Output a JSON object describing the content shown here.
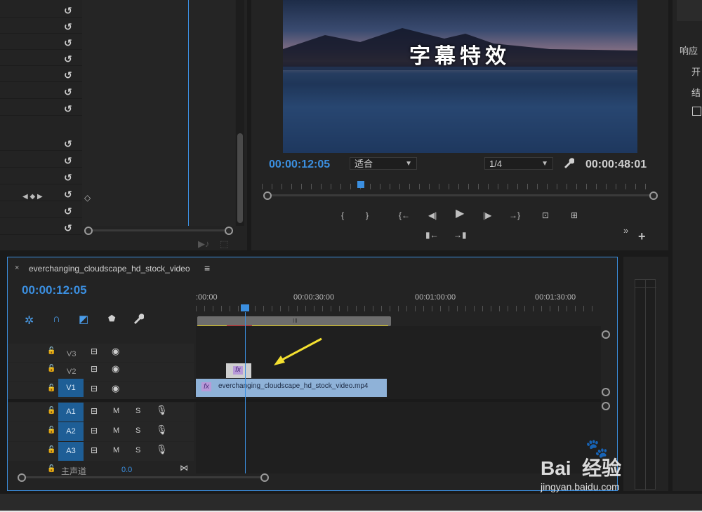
{
  "effects_panel": {
    "reset_icon": "reset-icon",
    "rows": 14
  },
  "program_monitor": {
    "video_caption": "字幕特效",
    "current_timecode": "00:00:12:05",
    "fit_dropdown": "适合",
    "resolution_dropdown": "1/4",
    "duration_timecode": "00:00:48:01",
    "controls": [
      "{",
      "}",
      "{←",
      "◀|",
      "▶",
      "|▶",
      "→}",
      "lift",
      "extract"
    ],
    "controls_row2": [
      "insert",
      "overwrite"
    ]
  },
  "right_panel": {
    "label1": "响应",
    "label2": "开",
    "label3": "结"
  },
  "timeline": {
    "close": "×",
    "sequence_name": "everchanging_cloudscape_hd_stock_video",
    "menu": "≡",
    "timecode": "00:00:12:05",
    "ruler_labels": [
      ":00:00",
      "00:00:30:00",
      "00:01:00:00",
      "00:01:30:00"
    ],
    "video_tracks": [
      {
        "name": "V3",
        "highlight": false
      },
      {
        "name": "V2",
        "highlight": false
      },
      {
        "name": "V1",
        "highlight": true
      }
    ],
    "audio_tracks": [
      {
        "name": "A1",
        "m": "M",
        "s": "S"
      },
      {
        "name": "A2",
        "m": "M",
        "s": "S"
      },
      {
        "name": "A3",
        "m": "M",
        "s": "S"
      }
    ],
    "master_label": "主声道",
    "master_value": "0.0",
    "clip_name": "everchanging_cloudscape_hd_stock_video.mp4",
    "fx_label": "fx"
  },
  "watermark": {
    "brand": "Bai  经验",
    "url": "jingyan.baidu.com"
  },
  "colors": {
    "accent_blue": "#3b8fe0",
    "clip_blue": "#8fb2d8",
    "track_badge": "#1e5e96",
    "arrow_yellow": "#f4e030"
  }
}
